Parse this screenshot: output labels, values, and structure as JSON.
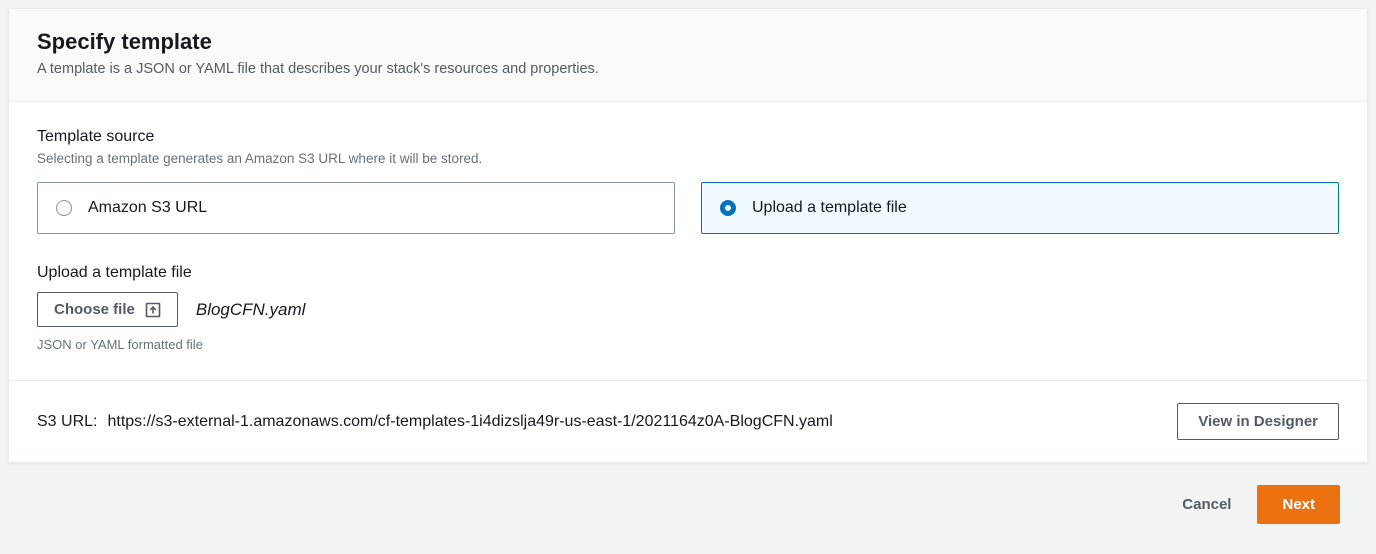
{
  "header": {
    "title": "Specify template",
    "description": "A template is a JSON or YAML file that describes your stack's resources and properties."
  },
  "templateSource": {
    "label": "Template source",
    "sub": "Selecting a template generates an Amazon S3 URL where it will be stored.",
    "options": {
      "s3": "Amazon S3 URL",
      "upload": "Upload a template file"
    },
    "selected": "upload"
  },
  "upload": {
    "label": "Upload a template file",
    "button": "Choose file",
    "filename": "BlogCFN.yaml",
    "hint": "JSON or YAML formatted file"
  },
  "footer": {
    "s3Label": "S3 URL:",
    "s3Url": "https://s3-external-1.amazonaws.com/cf-templates-1i4dizslja49r-us-east-1/2021164z0A-BlogCFN.yaml",
    "designer": "View in Designer"
  },
  "actions": {
    "cancel": "Cancel",
    "next": "Next"
  }
}
